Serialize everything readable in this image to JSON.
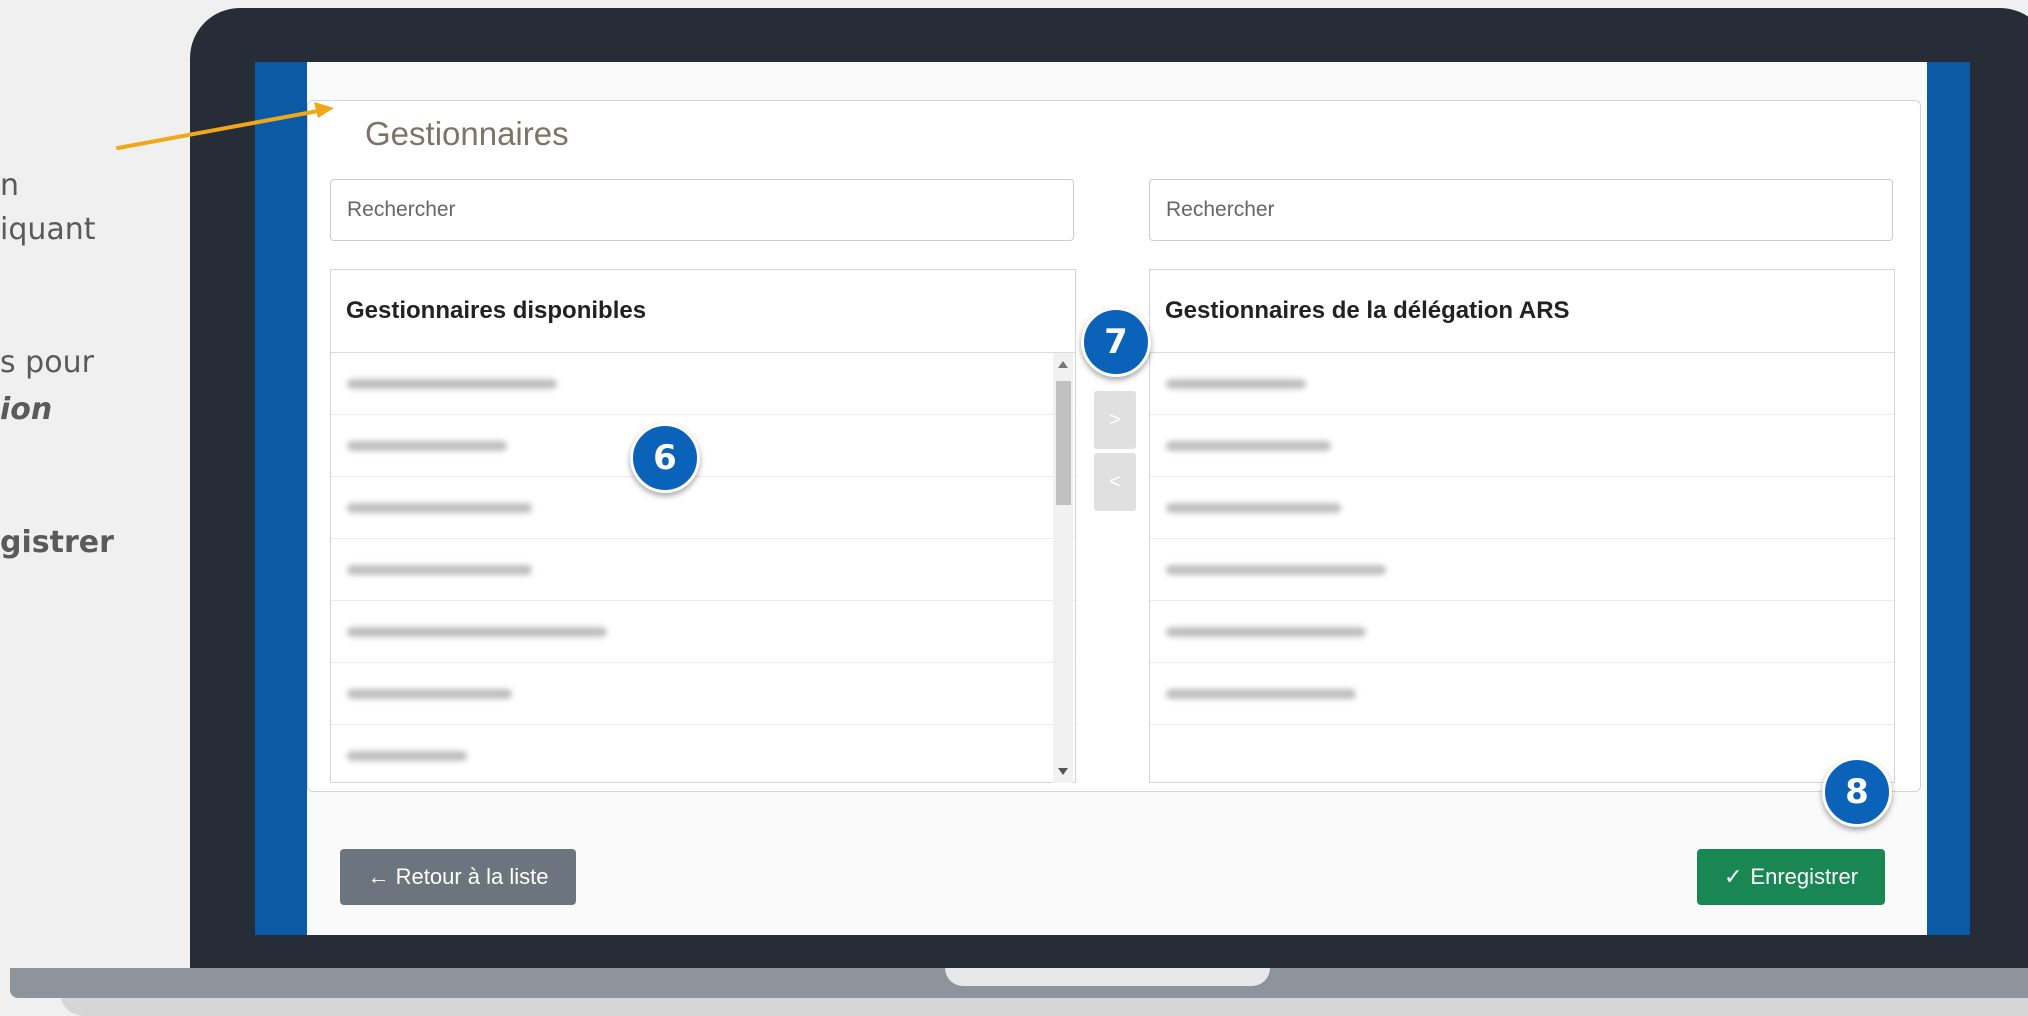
{
  "side_text": {
    "line1": "n",
    "line2": "iquant",
    "line3": "s pour",
    "line4": "ion",
    "line5": "gistrer"
  },
  "fieldset": {
    "legend": "Gestionnaires"
  },
  "left_panel": {
    "search_placeholder": "Rechercher",
    "title": "Gestionnaires disponibles",
    "row_count": 7
  },
  "right_panel": {
    "search_placeholder": "Rechercher",
    "title": "Gestionnaires de la délégation ARS",
    "row_count": 6
  },
  "transfer": {
    "add_label": ">",
    "remove_label": "<"
  },
  "badges": {
    "step6": "6",
    "step7": "7",
    "step8": "8"
  },
  "buttons": {
    "back_label": "← Retour à la liste",
    "save_check": "✓",
    "save_label": "Enregistrer"
  },
  "colors": {
    "frame": "#262d37",
    "screen_border": "#0a5aa5",
    "badge": "#0a63b8",
    "save": "#198754",
    "back": "#6c757d",
    "arrow": "#f0a81a"
  }
}
